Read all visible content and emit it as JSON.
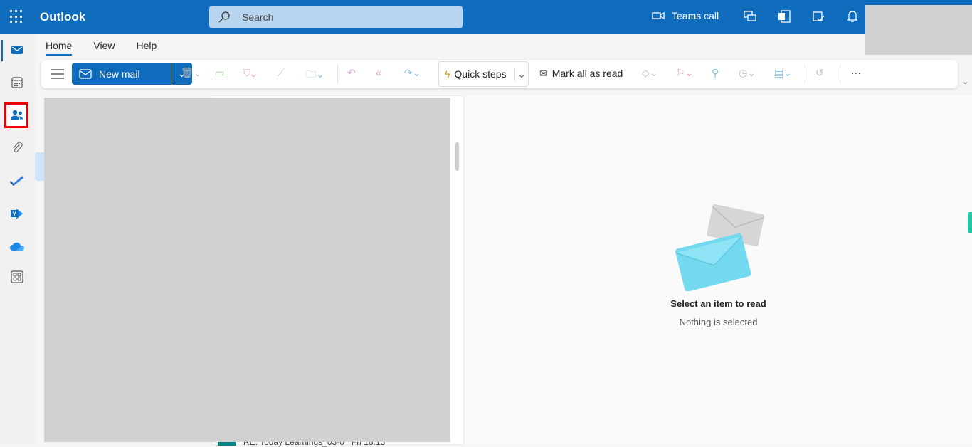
{
  "header": {
    "app_title": "Outlook",
    "search_placeholder": "Search",
    "teams_call": "Teams call"
  },
  "tabs": [
    {
      "label": "Home",
      "active": true
    },
    {
      "label": "View"
    },
    {
      "label": "Help"
    }
  ],
  "ribbon": {
    "new_mail": "New mail",
    "quick_steps": "Quick steps",
    "mark_all_read": "Mark all as read",
    "more": "···"
  },
  "rail": {
    "items": [
      "mail",
      "calendar",
      "people",
      "attachments",
      "to-do",
      "yammer",
      "onedrive",
      "apps"
    ],
    "highlighted": "people"
  },
  "message_list": {
    "peek_subject": "RE: Today Learnings_03-0",
    "peek_time": "Fri 18:13"
  },
  "reading_pane": {
    "title": "Select an item to read",
    "subtitle": "Nothing is selected"
  },
  "colors": {
    "brand": "#0f6cbd",
    "highlight": "#e00000"
  }
}
